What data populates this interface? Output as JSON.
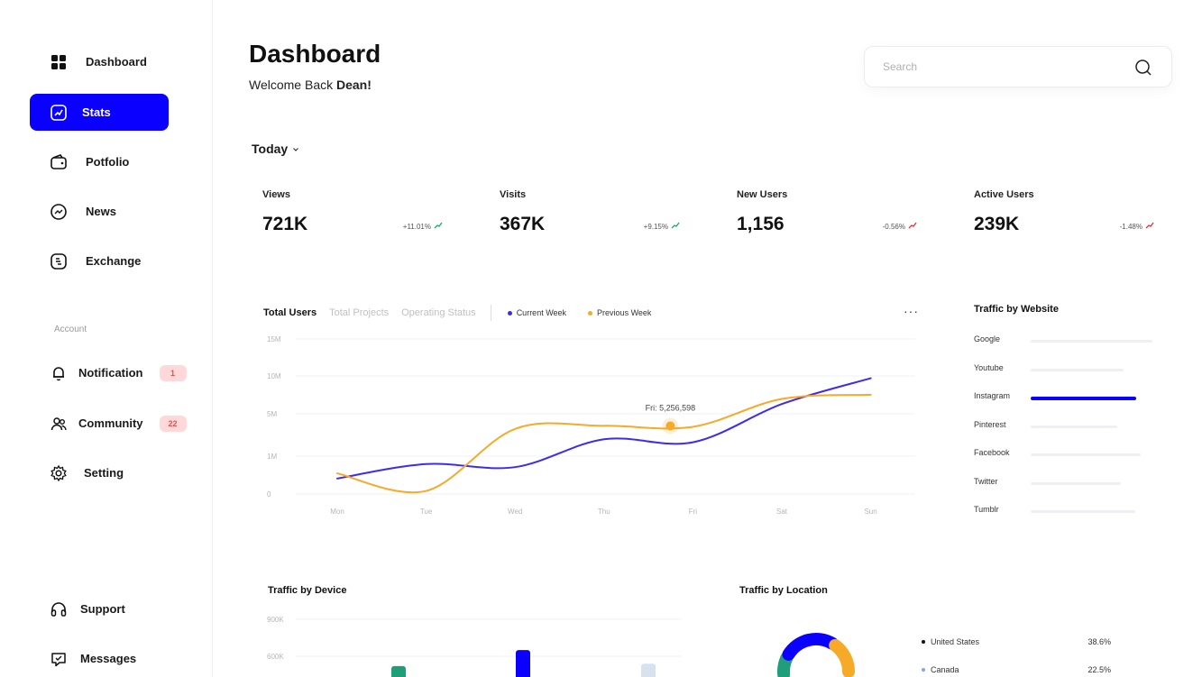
{
  "sidebar": {
    "main_items": [
      {
        "label": "Dashboard",
        "icon": "grid-icon",
        "active": false
      },
      {
        "label": "Stats",
        "icon": "chart-icon",
        "active": true
      },
      {
        "label": "Potfolio",
        "icon": "wallet-icon",
        "active": false
      },
      {
        "label": "News",
        "icon": "news-icon",
        "active": false
      },
      {
        "label": "Exchange",
        "icon": "exchange-icon",
        "active": false
      }
    ],
    "account_label": "Account",
    "account_items": [
      {
        "label": "Notification",
        "icon": "bell-icon",
        "badge": "1"
      },
      {
        "label": "Community",
        "icon": "users-icon",
        "badge": "22"
      },
      {
        "label": "Setting",
        "icon": "gear-icon"
      }
    ],
    "bottom_items": [
      {
        "label": "Support",
        "icon": "headset-icon"
      },
      {
        "label": "Messages",
        "icon": "message-icon"
      }
    ]
  },
  "header": {
    "title": "Dashboard",
    "welcome_prefix": "Welcome Back ",
    "user_name": "Dean!",
    "search_placeholder": "Search"
  },
  "period": "Today",
  "stats": [
    {
      "label": "Views",
      "value": "721K",
      "change": "+11.01%",
      "trend": "up"
    },
    {
      "label": "Visits",
      "value": "367K",
      "change": "+9.15%",
      "trend": "up"
    },
    {
      "label": "New Users",
      "value": "1,156",
      "change": "-0.56%",
      "trend": "down"
    },
    {
      "label": "Active Users",
      "value": "239K",
      "change": "-1.48%",
      "trend": "down"
    }
  ],
  "users_chart": {
    "tabs": [
      "Total Users",
      "Total Projects",
      "Operating Status"
    ],
    "active_tab": "Total Users",
    "more_label": "···",
    "colors": {
      "current": "#3d2cf0",
      "previous": "#f7a928",
      "up": "#19a974",
      "down": "#e0343a",
      "accent": "#0a00ff"
    }
  },
  "chart_data": [
    {
      "type": "line",
      "x": [
        "Mon",
        "Tue",
        "Wed",
        "Thu",
        "Fri",
        "Sat",
        "Sun"
      ],
      "y_ticks": [
        "0",
        "1M",
        "5M",
        "10M",
        "15M"
      ],
      "series": [
        {
          "name": "Current Week",
          "values": [
            1.5,
            2.9,
            2.6,
            5.3,
            5.0,
            8.7,
            11.2
          ]
        },
        {
          "name": "Previous Week",
          "values": [
            2.0,
            0.3,
            6.3,
            6.6,
            6.5,
            9.2,
            9.6
          ]
        }
      ],
      "annotation": {
        "label": "Fri: 5,256,598",
        "x": "Fri"
      },
      "grid": true,
      "legend_position": "top"
    },
    {
      "type": "bar",
      "title": "Traffic by Website",
      "categories": [
        "Google",
        "Youtube",
        "Instagram",
        "Pinterest",
        "Facebook",
        "Twitter",
        "Tumblr"
      ],
      "values": [
        1.0,
        0.76,
        0.87,
        0.71,
        0.9,
        0.74,
        0.86
      ],
      "highlight": "Instagram"
    },
    {
      "type": "bar",
      "title": "Traffic by Device",
      "y_ticks": [
        "600K",
        "900K"
      ],
      "values": [
        {
          "color": "#1f9e7a",
          "value": 520000
        },
        {
          "color": "#0a00ff",
          "value": 650000
        },
        {
          "color": "#d8e2ee",
          "value": 540000
        }
      ]
    },
    {
      "type": "pie",
      "title": "Traffic by Location",
      "labels": [
        "United States",
        "Canada"
      ],
      "values": [
        38.6,
        22.5
      ],
      "value_labels": [
        "38.6%",
        "22.5%"
      ],
      "colors": [
        "#111111",
        "#8b9ff4"
      ]
    }
  ]
}
